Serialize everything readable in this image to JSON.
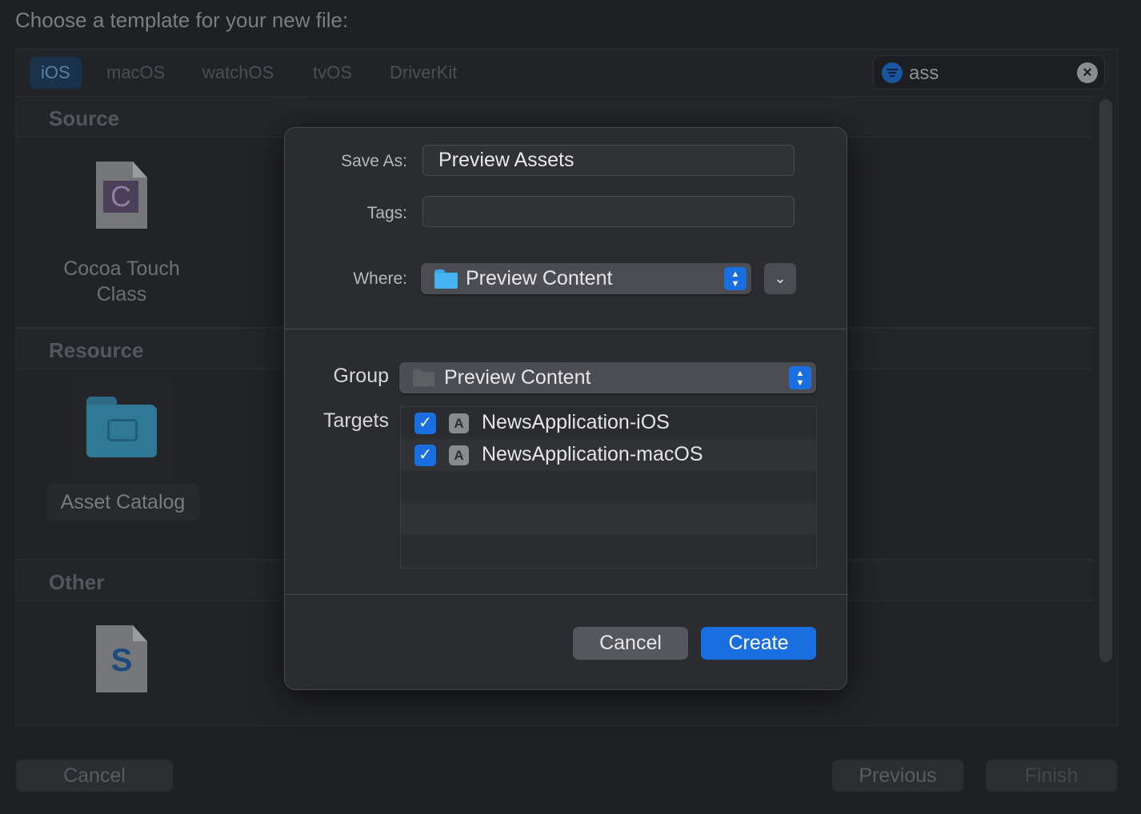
{
  "window": {
    "title": "Choose a template for your new file:"
  },
  "platform_tabs": [
    {
      "label": "iOS",
      "selected": true
    },
    {
      "label": "macOS",
      "selected": false
    },
    {
      "label": "watchOS",
      "selected": false
    },
    {
      "label": "tvOS",
      "selected": false
    },
    {
      "label": "DriverKit",
      "selected": false
    }
  ],
  "search": {
    "value": "ass",
    "filter_icon": "filter-icon",
    "clear_icon": "clear-icon"
  },
  "sections": {
    "source": {
      "header": "Source",
      "items": [
        {
          "label_line1": "Cocoa Touch",
          "label_line2": "Class",
          "icon": "C",
          "icon_name": "cocoa-touch-class-icon"
        }
      ]
    },
    "resource": {
      "header": "Resource",
      "items": [
        {
          "label": "Asset Catalog",
          "icon_name": "asset-catalog-folder-icon",
          "selected": true
        }
      ]
    },
    "other": {
      "header": "Other",
      "items": [
        {
          "label": "",
          "icon": "S",
          "icon_name": "swift-file-icon"
        }
      ]
    }
  },
  "footer": {
    "cancel": "Cancel",
    "previous": "Previous",
    "finish": "Finish"
  },
  "save_sheet": {
    "save_as_label": "Save As:",
    "save_as_value": "Preview Assets",
    "tags_label": "Tags:",
    "tags_value": "",
    "where_label": "Where:",
    "where_value": "Preview Content",
    "group_label": "Group",
    "group_value": "Preview Content",
    "targets_label": "Targets",
    "targets": [
      {
        "name": "NewsApplication-iOS",
        "checked": true
      },
      {
        "name": "NewsApplication-macOS",
        "checked": true
      }
    ],
    "cancel": "Cancel",
    "create": "Create"
  },
  "colors": {
    "accent": "#1a6fe0",
    "background": "#1f2023",
    "sheet": "#2a2c30"
  }
}
